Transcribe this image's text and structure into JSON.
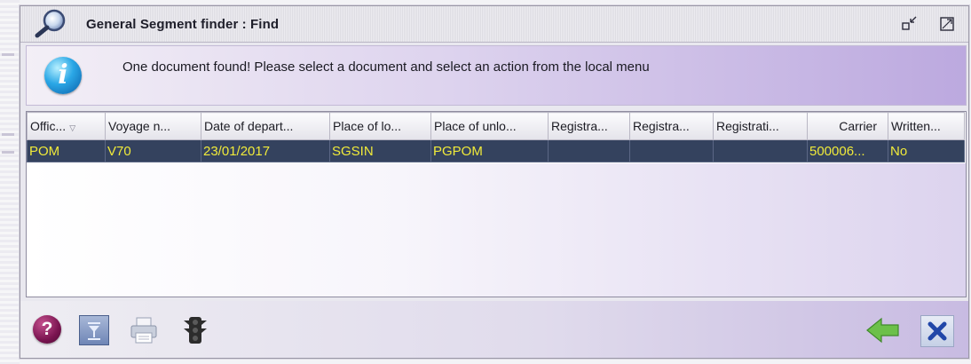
{
  "window": {
    "title": "General Segment finder : Find",
    "title_icon": "magnifier-icon",
    "minimize_icon": "restore-icon",
    "maximize_icon": "maximize-icon"
  },
  "message": {
    "icon": "info-icon",
    "text": "One document found! Please select a document and select an action from the local menu"
  },
  "table": {
    "columns": [
      "Offic...",
      "Voyage n...",
      "Date of depart...",
      "Place of lo...",
      "Place of unlo...",
      "Registra...",
      "Registra...",
      "Registrati...",
      "Carrier",
      "Written..."
    ],
    "rows": [
      [
        "POM",
        "V70",
        "23/01/2017",
        "SGSIN",
        "PGPOM",
        "",
        "",
        "",
        "500006...",
        "No"
      ]
    ]
  },
  "toolbar": {
    "help_icon": "help-icon",
    "help_label": "?",
    "filter_icon": "filter-icon",
    "print_icon": "printer-icon",
    "traffic_icon": "traffic-light-icon",
    "back_icon": "back-arrow-icon",
    "close_icon": "close-icon"
  },
  "colors": {
    "selected_row_bg": "#34425e",
    "selected_row_text": "#f0ea3a",
    "accent_purple": "#bca9df"
  }
}
